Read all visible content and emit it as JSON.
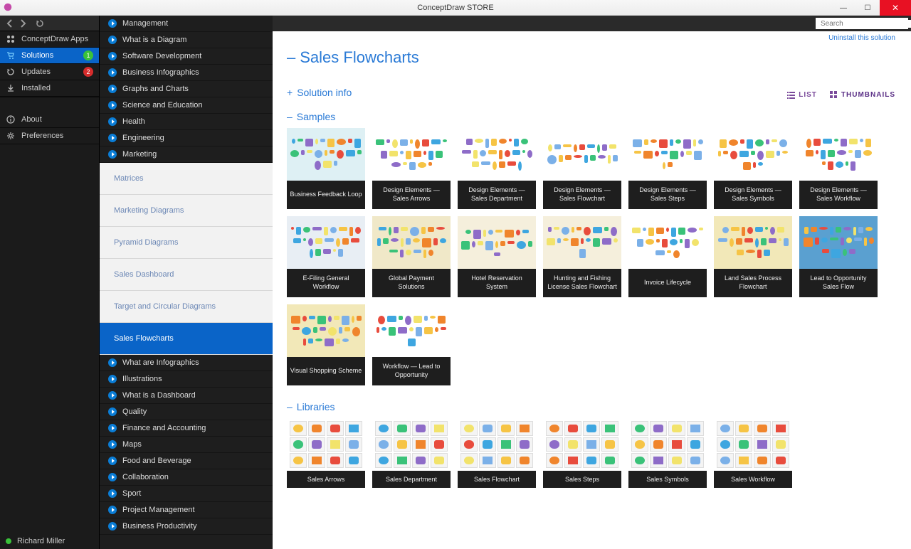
{
  "window": {
    "title": "ConceptDraw STORE"
  },
  "search": {
    "placeholder": "Search"
  },
  "uninstall_link": "Uninstall this solution",
  "sidebar": {
    "items": [
      {
        "label": "ConceptDraw Apps",
        "icon": "apps"
      },
      {
        "label": "Solutions",
        "icon": "cart",
        "selected": true,
        "badge": "1",
        "badge_color": "#3ac23a"
      },
      {
        "label": "Updates",
        "icon": "update",
        "badge": "2",
        "badge_color": "#d62c2c"
      },
      {
        "label": "Installed",
        "icon": "installed"
      }
    ],
    "bottom": [
      {
        "label": "About",
        "icon": "info"
      },
      {
        "label": "Preferences",
        "icon": "gear"
      }
    ],
    "user": "Richard Miller"
  },
  "categories": [
    {
      "type": "cat",
      "label": "Management"
    },
    {
      "type": "cat",
      "label": "What is a Diagram"
    },
    {
      "type": "cat",
      "label": "Software Development"
    },
    {
      "type": "cat",
      "label": "Business Infographics"
    },
    {
      "type": "cat",
      "label": "Graphs and Charts"
    },
    {
      "type": "cat",
      "label": "Science and Education"
    },
    {
      "type": "cat",
      "label": "Health"
    },
    {
      "type": "cat",
      "label": "Engineering"
    },
    {
      "type": "cat",
      "label": "Marketing"
    },
    {
      "type": "sub",
      "label": "Matrices"
    },
    {
      "type": "sub",
      "label": "Marketing Diagrams"
    },
    {
      "type": "sub",
      "label": "Pyramid Diagrams"
    },
    {
      "type": "sub",
      "label": "Sales Dashboard"
    },
    {
      "type": "sub",
      "label": "Target and Circular Diagrams"
    },
    {
      "type": "sub",
      "label": "Sales Flowcharts",
      "selected": true
    },
    {
      "type": "cat",
      "label": "What are Infographics"
    },
    {
      "type": "cat",
      "label": "Illustrations"
    },
    {
      "type": "cat",
      "label": "What is a Dashboard"
    },
    {
      "type": "cat",
      "label": "Quality"
    },
    {
      "type": "cat",
      "label": "Finance and Accounting"
    },
    {
      "type": "cat",
      "label": "Maps"
    },
    {
      "type": "cat",
      "label": "Food and Beverage"
    },
    {
      "type": "cat",
      "label": "Collaboration"
    },
    {
      "type": "cat",
      "label": "Sport"
    },
    {
      "type": "cat",
      "label": "Project Management"
    },
    {
      "type": "cat",
      "label": "Business Productivity"
    }
  ],
  "page": {
    "title": "Sales Flowcharts",
    "solution_info": "Solution info",
    "samples_heading": "Samples",
    "libraries_heading": "Libraries",
    "view_list": "LIST",
    "view_thumb": "THUMBNAILS"
  },
  "samples": [
    {
      "label": "Business Feedback Loop"
    },
    {
      "label": "Design Elements — Sales Arrows"
    },
    {
      "label": "Design Elements — Sales Department"
    },
    {
      "label": "Design Elements — Sales Flowchart"
    },
    {
      "label": "Design Elements — Sales Steps"
    },
    {
      "label": "Design Elements — Sales Symbols"
    },
    {
      "label": "Design Elements — Sales Workflow"
    },
    {
      "label": "E-Filing General Workflow"
    },
    {
      "label": "Global Payment Solutions"
    },
    {
      "label": "Hotel Reservation System"
    },
    {
      "label": "Hunting and Fishing License Sales Flowchart"
    },
    {
      "label": "Invoice Lifecycle"
    },
    {
      "label": "Land Sales Process Flowchart"
    },
    {
      "label": "Lead to Opportunity Sales Flow"
    },
    {
      "label": "Visual Shopping Scheme"
    },
    {
      "label": "Workflow — Lead to Opportunity"
    }
  ],
  "libraries": [
    {
      "label": "Sales Arrows"
    },
    {
      "label": "Sales Department"
    },
    {
      "label": "Sales Flowchart"
    },
    {
      "label": "Sales Steps"
    },
    {
      "label": "Sales Symbols"
    },
    {
      "label": "Sales Workflow"
    }
  ],
  "palette": [
    "#f6c445",
    "#f0852c",
    "#e84c3d",
    "#3ea6e0",
    "#3ac279",
    "#8e6cc8",
    "#f2e36b",
    "#7bb0e8"
  ]
}
